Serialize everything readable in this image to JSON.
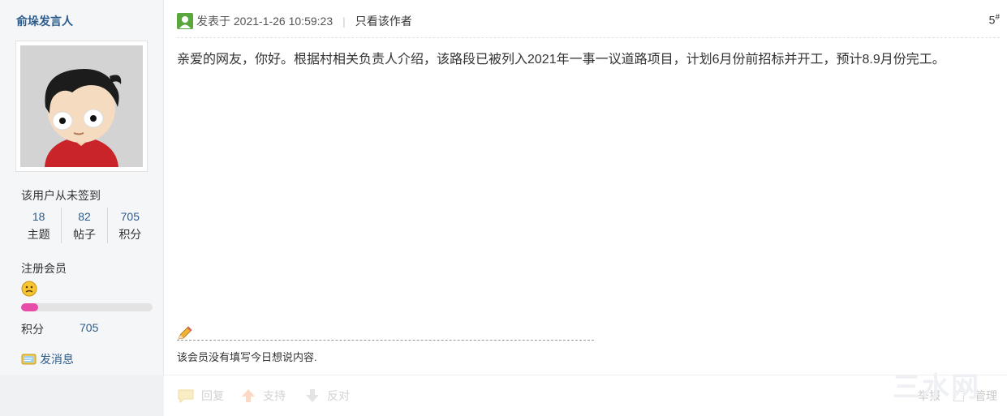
{
  "author": {
    "name": "俞垛发言人",
    "signin_text": "该用户从未签到",
    "stats": [
      {
        "value": "18",
        "label": "主题"
      },
      {
        "value": "82",
        "label": "帖子"
      },
      {
        "value": "705",
        "label": "积分"
      }
    ],
    "group": "注册会员",
    "progress_percent": 13,
    "points_label": "积分",
    "points_value": "705",
    "send_message": "发消息"
  },
  "post": {
    "posted_prefix": "发表于",
    "posted_time": "2021-1-26 10:59:23",
    "separator": "|",
    "author_only": "只看该作者",
    "floor_number": "5",
    "floor_mark": "#",
    "content": "亲爱的网友，你好。根据村相关负责人介绍，该路段已被列入2021年一事一议道路项目，计划6月份前招标并开工，预计8.9月份完工。",
    "signature": "该会员没有填写今日想说内容."
  },
  "actions": {
    "reply": "回复",
    "support": "支持",
    "oppose": "反对",
    "report": "举报",
    "manage": "管理"
  },
  "watermark": "三水网",
  "colors": {
    "link": "#2b5b8a",
    "progress": "#e74da8",
    "sidebar_bg": "#f5f6f8"
  },
  "icons": {
    "user": "user-icon",
    "pencil": "pencil-icon",
    "message": "message-icon",
    "smiley": "smiley-icon",
    "reply": "reply-icon",
    "support": "thumb-up-icon",
    "oppose": "thumb-down-icon"
  }
}
